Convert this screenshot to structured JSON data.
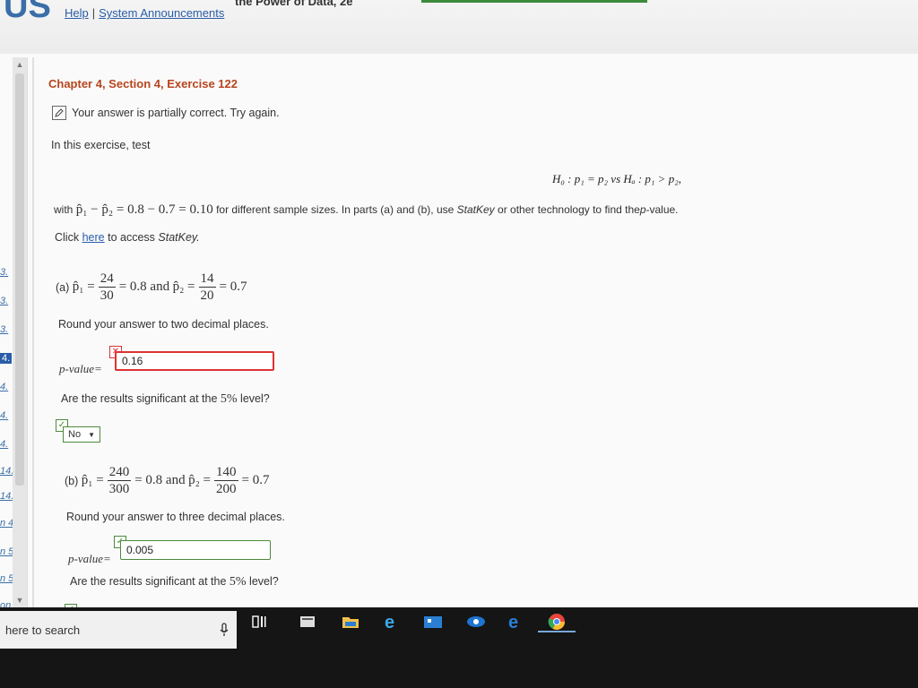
{
  "header": {
    "logo_text": "US",
    "book_title_fragment": "the Power of Data, 2e",
    "help_link": "Help",
    "announcements_link": "System Announcements"
  },
  "sidebar": {
    "items": [
      {
        "label": "3."
      },
      {
        "label": "3."
      },
      {
        "label": "3."
      },
      {
        "label": "4."
      },
      {
        "label": "4."
      },
      {
        "label": "4."
      },
      {
        "label": "4."
      },
      {
        "label": "14."
      },
      {
        "label": "14."
      },
      {
        "label": "n 4."
      },
      {
        "label": "n 5."
      },
      {
        "label": "n 5."
      },
      {
        "label": "on 5."
      }
    ]
  },
  "exercise": {
    "title": "Chapter 4, Section 4, Exercise 122",
    "status": "Your answer is partially correct.  Try again.",
    "intro": "In this exercise, test",
    "hypothesis": "H₀ : p₁ = p₂  vs  Hₐ : p₁ > p₂,",
    "with_prefix": "with",
    "with_math": "p̂₁ − p̂₂ = 0.8 − 0.7 = 0.10",
    "with_suffix": "for different sample sizes. In parts (a) and (b), use",
    "statkey": "StatKey",
    "with_suffix2": "or other technology to find the",
    "pvalue_word": "p",
    "with_suffix3": "-value.",
    "click_prefix": "Click",
    "click_link": "here",
    "click_suffix": "to access",
    "click_statkey": "StatKey."
  },
  "part_a": {
    "label": "(a)",
    "p1": "p̂₁ =",
    "num1": "24",
    "den1": "30",
    "eq1": "= 0.8 and",
    "p2": "p̂₂ =",
    "num2": "14",
    "den2": "20",
    "eq2": "= 0.7",
    "round_text": "Round your answer to two decimal places.",
    "pvalue_label": "p-value=",
    "answer": "0.16",
    "significance_prefix": "Are the results significant at the",
    "significance_level": "5%",
    "significance_suffix": "level?",
    "select_value": "No"
  },
  "part_b": {
    "label": "(b)",
    "p1": "p̂₁ =",
    "num1": "240",
    "den1": "300",
    "eq1": "= 0.8 and",
    "p2": "p̂₂ =",
    "num2": "140",
    "den2": "200",
    "eq2": "= 0.7",
    "round_text": "Round your answer to three decimal places.",
    "pvalue_label": "p-value=",
    "answer": "0.005",
    "significance_prefix": "Are the results significant at the",
    "significance_level": "5%",
    "significance_suffix": "level?"
  },
  "taskbar": {
    "search_placeholder": "here to search"
  },
  "colors": {
    "title": "#b7451d",
    "link": "#2a5da8",
    "wrong": "#dd3333",
    "correct": "#4d8a3c"
  }
}
